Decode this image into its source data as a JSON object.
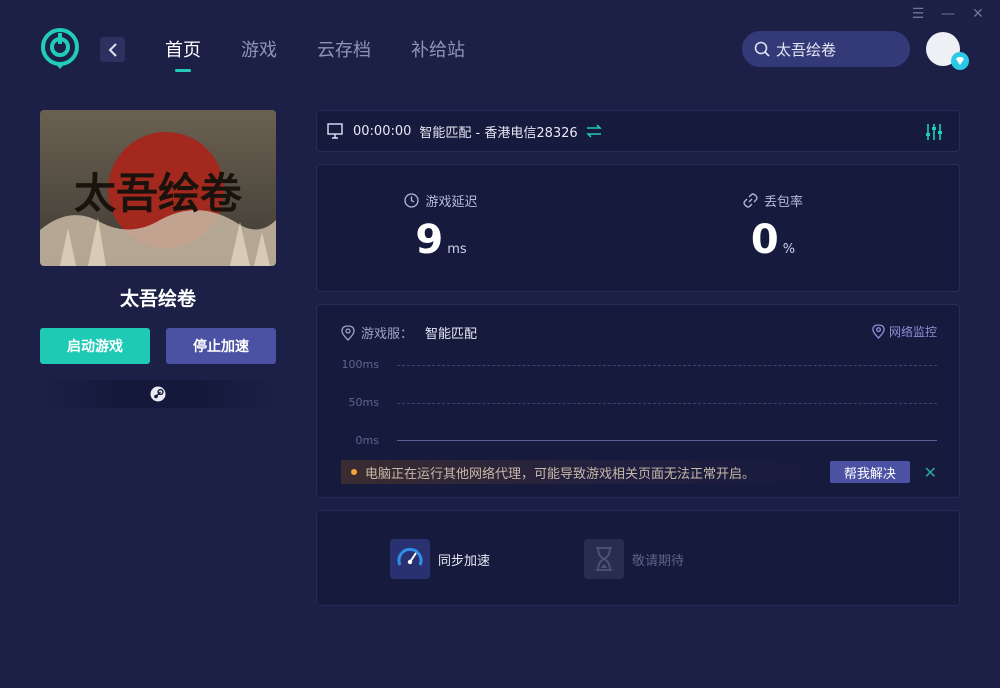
{
  "window": {
    "menu_icon": "menu-icon",
    "minimize_icon": "minimize-icon",
    "close_icon": "close-icon"
  },
  "nav": {
    "items": [
      {
        "label": "首页",
        "active": true
      },
      {
        "label": "游戏",
        "active": false
      },
      {
        "label": "云存档",
        "active": false
      },
      {
        "label": "补给站",
        "active": false
      }
    ]
  },
  "search": {
    "value": "太吾绘卷"
  },
  "game": {
    "title": "太吾绘卷",
    "cover_text": "太吾绘卷"
  },
  "buttons": {
    "start": "启动游戏",
    "stop": "停止加速"
  },
  "route": {
    "timer": "00:00:00",
    "text": "智能匹配 - 香港电信28326"
  },
  "stats": {
    "latency_label": "游戏延迟",
    "latency_value": "9",
    "latency_unit": "ms",
    "loss_label": "丢包率",
    "loss_value": "0",
    "loss_unit": "%"
  },
  "chart": {
    "server_label": "游戏服：",
    "server_value": "智能匹配",
    "monitor_label": "网络监控",
    "ticks": [
      "100ms",
      "50ms",
      "0ms"
    ]
  },
  "warning": {
    "text": "电脑正在运行其他网络代理，可能导致游戏相关页面无法正常开启。",
    "button": "帮我解决"
  },
  "tools": [
    {
      "label": "同步加速",
      "enabled": true
    },
    {
      "label": "敬请期待",
      "enabled": false
    }
  ],
  "colors": {
    "accent": "#21cdb8",
    "secondary": "#4b51a3",
    "background": "#1c2046",
    "warning": "#f2a63a"
  }
}
